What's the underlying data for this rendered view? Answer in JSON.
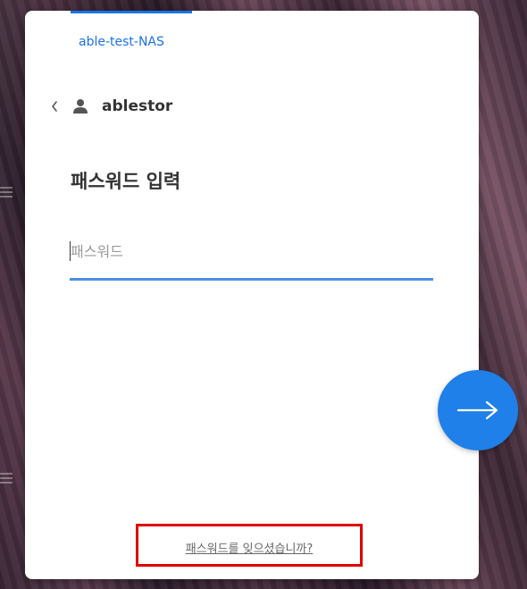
{
  "nas_name": "able-test-NAS",
  "username": "ablestor",
  "title": "패스워드 입력",
  "password_field": {
    "placeholder": "패스워드",
    "value": ""
  },
  "forgot_link": "패스워드를 잊으셨습니까?",
  "colors": {
    "accent": "#1a73e8",
    "input_underline": "#4a90e2",
    "next_button": "#1e80e8",
    "highlight_box": "#e00000"
  },
  "icons": {
    "back": "chevron-left-icon",
    "user": "user-icon",
    "next": "arrow-right-icon"
  }
}
